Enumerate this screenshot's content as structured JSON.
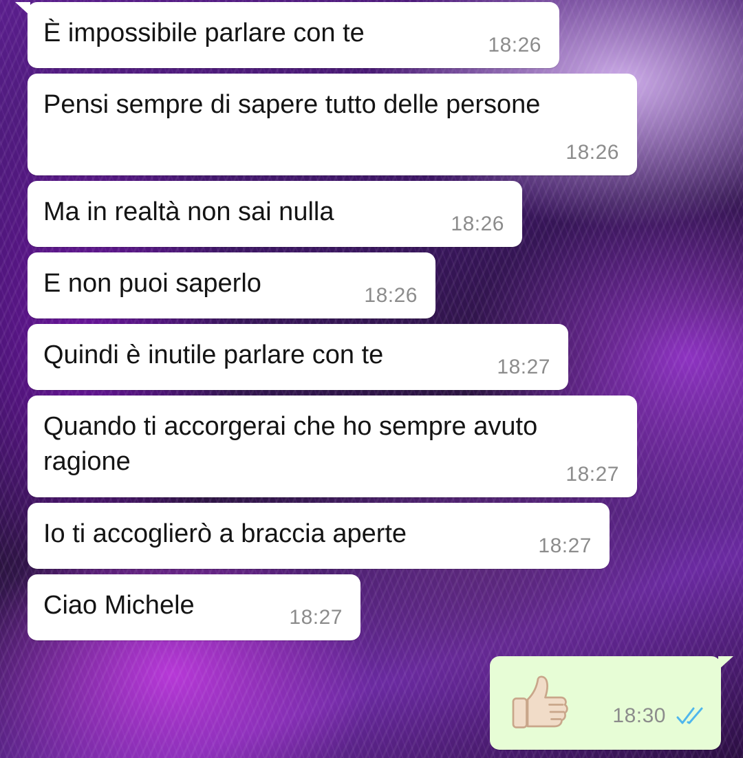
{
  "chat": {
    "incoming": [
      {
        "text": "È impossibile parlare con te",
        "time": "18:26"
      },
      {
        "text": "Pensi sempre di sapere tutto delle persone",
        "time": "18:26"
      },
      {
        "text": "Ma in realtà non sai nulla",
        "time": "18:26"
      },
      {
        "text": "E non puoi saperlo",
        "time": "18:26"
      },
      {
        "text": "Quindi è inutile parlare con te",
        "time": "18:27"
      },
      {
        "text": "Quando ti accorgerai che ho sempre avuto\nragione",
        "time": "18:27"
      },
      {
        "text": "Io ti accoglierò a braccia aperte",
        "time": "18:27"
      },
      {
        "text": "Ciao Michele",
        "time": "18:27"
      }
    ],
    "outgoing": [
      {
        "content_icon": "thumbs-up-emoji",
        "time": "18:30",
        "status_icon": "double-check-read-icon"
      }
    ]
  },
  "colors": {
    "incoming_bubble": "#ffffff",
    "outgoing_bubble": "#e7fdd6",
    "time_text": "#8c8c8c",
    "read_ticks": "#4fb6ec"
  }
}
